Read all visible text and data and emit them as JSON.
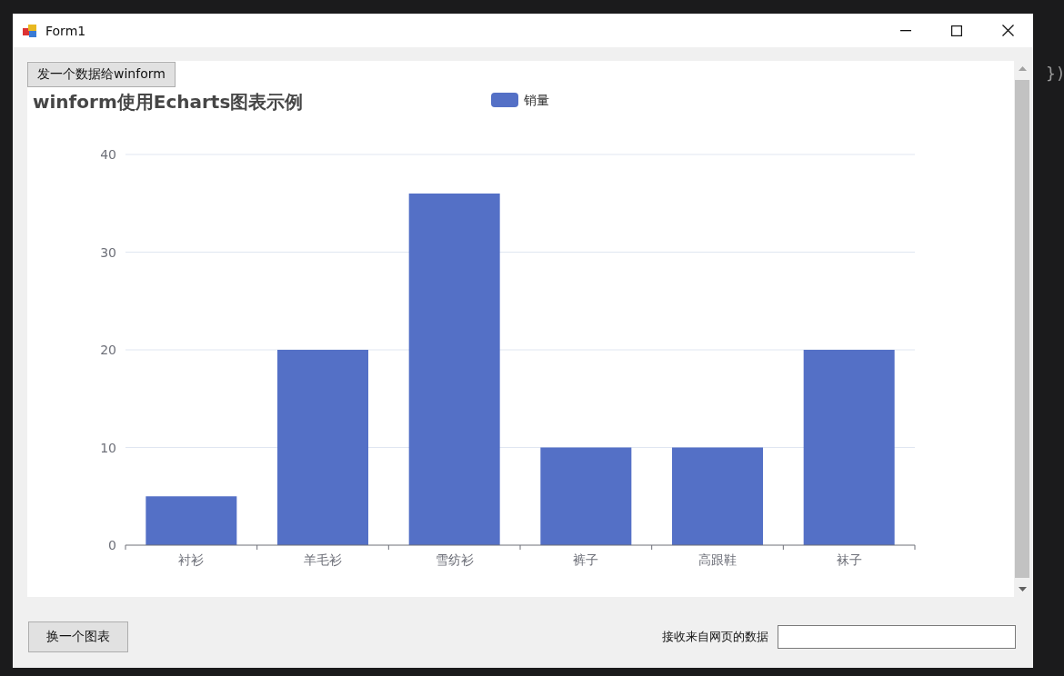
{
  "background_code": [
    {
      "text": "})"
    }
  ],
  "window": {
    "title": "Form1"
  },
  "send_button": "发一个数据给winform",
  "chart_data": {
    "type": "bar",
    "title": "winform使用Echarts图表示例",
    "categories": [
      "衬衫",
      "羊毛衫",
      "雪纺衫",
      "裤子",
      "高跟鞋",
      "袜子"
    ],
    "series": [
      {
        "name": "销量",
        "color": "#5470c6",
        "values": [
          5,
          20,
          36,
          10,
          10,
          20
        ]
      }
    ],
    "ylim": [
      0,
      40
    ],
    "yticks": [
      0,
      10,
      20,
      30,
      40
    ],
    "grid": true
  },
  "switch_button": "换一个图表",
  "receive_label": "接收来自网页的数据"
}
